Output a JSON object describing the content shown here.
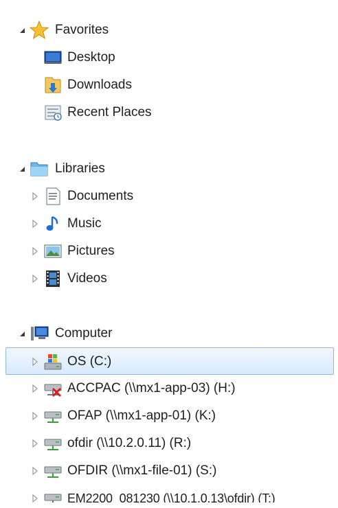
{
  "favorites": {
    "label": "Favorites",
    "items": [
      {
        "label": "Desktop"
      },
      {
        "label": "Downloads"
      },
      {
        "label": "Recent Places"
      }
    ]
  },
  "libraries": {
    "label": "Libraries",
    "items": [
      {
        "label": "Documents"
      },
      {
        "label": "Music"
      },
      {
        "label": "Pictures"
      },
      {
        "label": "Videos"
      }
    ]
  },
  "computer": {
    "label": "Computer",
    "drives": [
      {
        "label": "OS (C:)",
        "selected": true
      },
      {
        "label": "ACCPAC (\\\\mx1-app-03) (H:)",
        "disconnected": true
      },
      {
        "label": "OFAP (\\\\mx1-app-01) (K:)"
      },
      {
        "label": "ofdir (\\\\10.2.0.11) (R:)"
      },
      {
        "label": "OFDIR (\\\\mx1-file-01) (S:)"
      },
      {
        "label": "EM2200_081230 (\\\\10.1.0.13\\ofdir) (T:)"
      }
    ]
  },
  "colors": {
    "selection_fill": "#d8eafd",
    "selection_border": "#90b7e0",
    "text": "#1e1e1e"
  }
}
